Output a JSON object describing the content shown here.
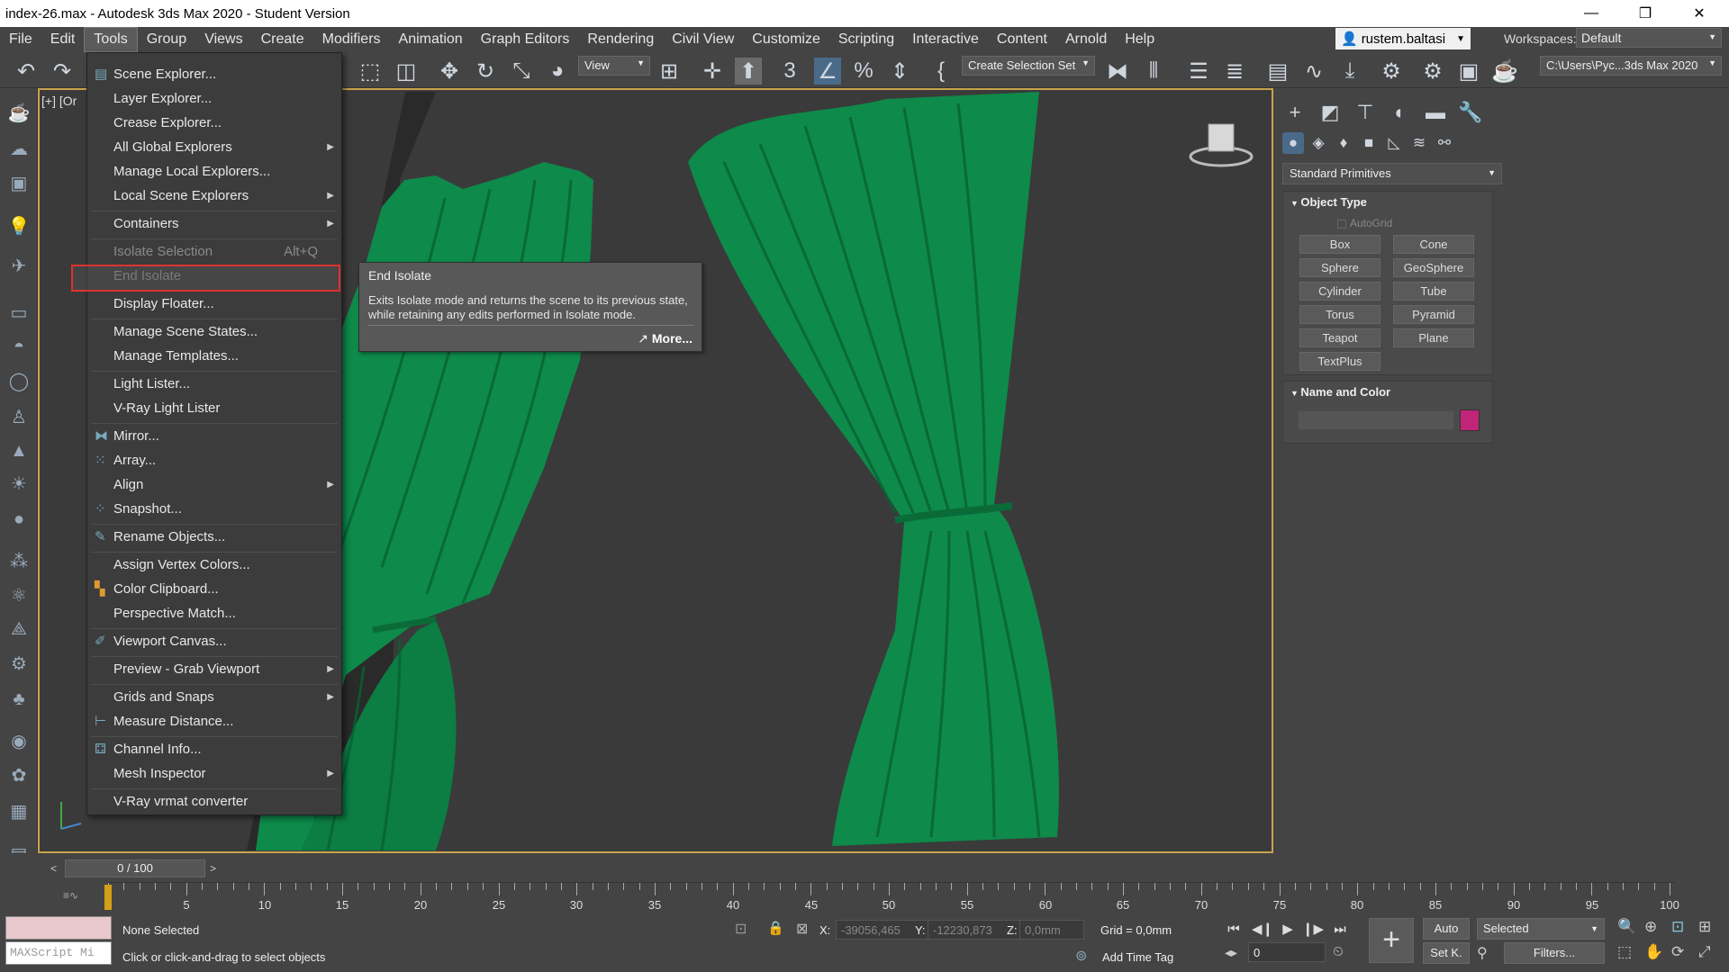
{
  "window": {
    "title": "index-26.max - Autodesk 3ds Max 2020 - Student Version",
    "minimize": "—",
    "restore": "❐",
    "close": "✕"
  },
  "menubar": {
    "items": [
      "File",
      "Edit",
      "Tools",
      "Group",
      "Views",
      "Create",
      "Modifiers",
      "Animation",
      "Graph Editors",
      "Rendering",
      "Civil View",
      "Customize",
      "Scripting",
      "Interactive",
      "Content",
      "Arnold",
      "Help"
    ],
    "active": "Tools"
  },
  "user": {
    "name": "rustem.baltasi"
  },
  "workspace": {
    "label": "Workspaces:",
    "value": "Default"
  },
  "toolbar": {
    "view_dropdown": "View",
    "selection_set": "Create Selection Set",
    "path": "C:\\Users\\Pyc...3ds Max 2020"
  },
  "viewport": {
    "label": "[+] [Or"
  },
  "tools_menu": {
    "items": [
      {
        "label": "Scene Explorer...",
        "icon": "scene-explorer-icon",
        "submenu": false,
        "disabled": false
      },
      {
        "label": "Layer Explorer...",
        "submenu": false,
        "disabled": false
      },
      {
        "label": "Crease Explorer...",
        "submenu": false,
        "disabled": false
      },
      {
        "label": "All Global Explorers",
        "submenu": true,
        "disabled": false
      },
      {
        "label": "Manage Local Explorers...",
        "submenu": false,
        "disabled": false
      },
      {
        "label": "Local Scene Explorers",
        "submenu": true,
        "disabled": false
      },
      {
        "label": "Containers",
        "submenu": true,
        "disabled": false
      },
      {
        "label": "Isolate Selection",
        "shortcut": "Alt+Q",
        "submenu": false,
        "disabled": true
      },
      {
        "label": "End Isolate",
        "submenu": false,
        "disabled": true
      },
      {
        "label": "Display Floater...",
        "submenu": false,
        "disabled": false
      },
      {
        "label": "Manage Scene States...",
        "submenu": false,
        "disabled": false
      },
      {
        "label": "Manage Templates...",
        "submenu": false,
        "disabled": false
      },
      {
        "label": "Light Lister...",
        "submenu": false,
        "disabled": false
      },
      {
        "label": "V-Ray Light Lister",
        "submenu": false,
        "disabled": false
      },
      {
        "label": "Mirror...",
        "icon": "mirror-icon",
        "submenu": false,
        "disabled": false
      },
      {
        "label": "Array...",
        "icon": "array-icon",
        "submenu": false,
        "disabled": false
      },
      {
        "label": "Align",
        "submenu": true,
        "disabled": false
      },
      {
        "label": "Snapshot...",
        "icon": "snapshot-icon",
        "submenu": false,
        "disabled": false
      },
      {
        "label": "Rename Objects...",
        "icon": "rename-icon",
        "submenu": false,
        "disabled": false
      },
      {
        "label": "Assign Vertex Colors...",
        "submenu": false,
        "disabled": false
      },
      {
        "label": "Color Clipboard...",
        "icon": "color-clipboard-icon",
        "submenu": false,
        "disabled": false
      },
      {
        "label": "Perspective Match...",
        "submenu": false,
        "disabled": false
      },
      {
        "label": "Viewport Canvas...",
        "icon": "brush-icon",
        "submenu": false,
        "disabled": false
      },
      {
        "label": "Preview - Grab Viewport",
        "submenu": true,
        "disabled": false
      },
      {
        "label": "Grids and Snaps",
        "submenu": true,
        "disabled": false
      },
      {
        "label": "Measure Distance...",
        "icon": "measure-icon",
        "submenu": false,
        "disabled": false
      },
      {
        "label": "Channel Info...",
        "icon": "channel-info-icon",
        "submenu": false,
        "disabled": false
      },
      {
        "label": "Mesh Inspector",
        "submenu": true,
        "disabled": false
      },
      {
        "label": "V-Ray vrmat converter",
        "submenu": false,
        "disabled": false
      }
    ]
  },
  "tooltip": {
    "title": "End Isolate",
    "description": "Exits Isolate mode and returns the scene to its previous state, while retaining any edits performed in Isolate mode.",
    "more": "More..."
  },
  "command_panel": {
    "category": "Standard Primitives",
    "object_type": {
      "title": "Object Type",
      "autogrid": "AutoGrid",
      "buttons": [
        "Box",
        "Cone",
        "Sphere",
        "GeoSphere",
        "Cylinder",
        "Tube",
        "Torus",
        "Pyramid",
        "Teapot",
        "Plane",
        "TextPlus"
      ]
    },
    "name_color": {
      "title": "Name and Color",
      "swatch": "#c1257a"
    }
  },
  "timeline": {
    "frame": "0 / 100",
    "ticks": [
      "5",
      "10",
      "15",
      "20",
      "25",
      "30",
      "35",
      "40",
      "45",
      "50",
      "55",
      "60",
      "65",
      "70",
      "75",
      "80",
      "85",
      "90",
      "95",
      "100"
    ]
  },
  "status": {
    "maxscript": "MAXScript Mi",
    "selection": "None Selected",
    "prompt": "Click or click-and-drag to select objects",
    "x_label": "X:",
    "x_value": "-39056,465",
    "y_label": "Y:",
    "y_value": "-12230,873",
    "z_label": "Z:",
    "z_value": "0,0mm",
    "grid": "Grid = 0,0mm",
    "add_time_tag": "Add Time Tag",
    "auto": "Auto",
    "set_key": "Set K.",
    "selected": "Selected",
    "filters": "Filters...",
    "frame_value": "0"
  },
  "colors": {
    "curtain": "#0e8a4a",
    "highlight": "#e03030",
    "viewport_border": "#c9a44d"
  }
}
